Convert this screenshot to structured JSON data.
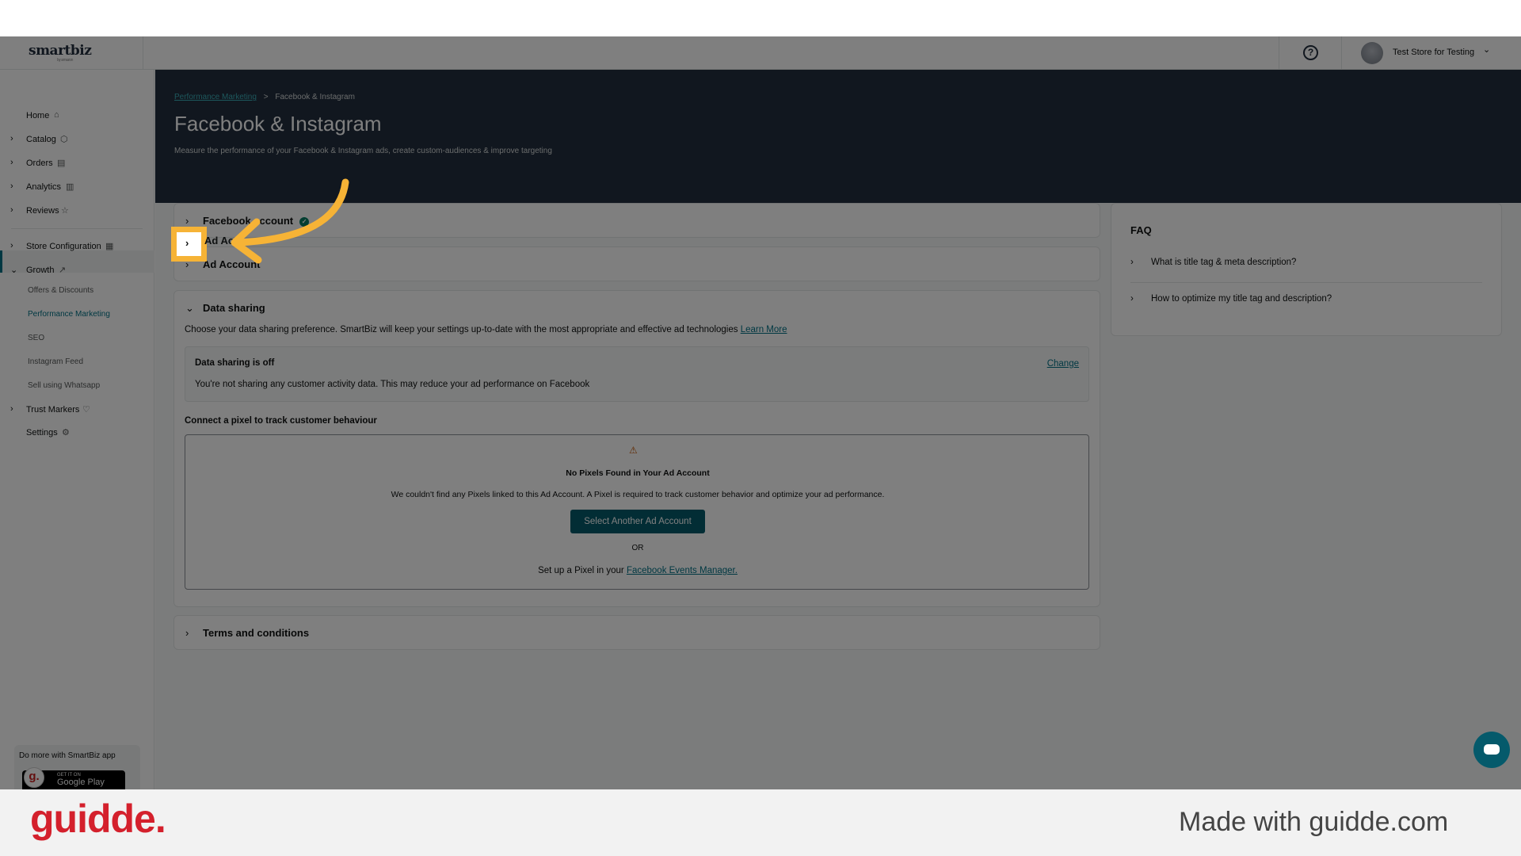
{
  "topbar": {
    "logo": "smartbiz",
    "logo_sub": "by amazon",
    "help": "?",
    "store_name": "Test Store for Testing",
    "menu_chevron": "⌄"
  },
  "sidebar": {
    "items": [
      {
        "label": "Home",
        "icon": "home-icon"
      },
      {
        "label": "Catalog",
        "icon": "cube-icon"
      },
      {
        "label": "Orders",
        "icon": "clipboard-icon"
      },
      {
        "label": "Analytics",
        "icon": "bar-chart-icon"
      },
      {
        "label": "Reviews",
        "icon": "star-icon"
      },
      {
        "label": "Store Configuration",
        "icon": "store-icon"
      },
      {
        "label": "Growth",
        "icon": "trend-up-icon"
      },
      {
        "label": "Trust Markers",
        "icon": "shield-heart-icon"
      },
      {
        "label": "Settings",
        "icon": "gear-icon"
      }
    ],
    "growth_sub": [
      {
        "label": "Offers & Discounts"
      },
      {
        "label": "Performance Marketing"
      },
      {
        "label": "SEO"
      },
      {
        "label": "Instagram Feed"
      },
      {
        "label": "Sell using Whatsapp"
      }
    ],
    "promo_text": "Do more with SmartBiz app",
    "store_badge_small": "GET IT ON",
    "store_badge": "Google Play",
    "guidde_badge": "g."
  },
  "header": {
    "breadcrumb_link": "Performance Marketing",
    "breadcrumb_sep": ">",
    "breadcrumb_current": "Facebook & Instagram",
    "title": "Facebook & Instagram",
    "subtitle": "Measure the performance of your Facebook & Instagram ads, create custom-audiences & improve targeting"
  },
  "sections": {
    "facebook_account": "Facebook account",
    "ad_account": "Ad Account",
    "ad_account_visible": "Ad Ac",
    "data_sharing": "Data sharing",
    "terms": "Terms and conditions"
  },
  "data_sharing": {
    "intro": "Choose your data sharing preference. SmartBiz will keep your settings up-to-date with the most appropriate and effective ad technologies",
    "learn_more": "Learn More",
    "status_title": "Data sharing is off",
    "status_desc": "You're not sharing any customer activity data. This may reduce your ad performance on Facebook",
    "change": "Change",
    "pixel_title": "Connect a pixel to track customer behaviour",
    "no_pixels_title": "No Pixels Found in Your Ad Account",
    "no_pixels_desc": "We couldn't find any Pixels linked to this Ad Account. A Pixel is required to track customer behavior and optimize your ad performance.",
    "select_button": "Select Another Ad Account",
    "or": "OR",
    "setup_prefix": "Set up a Pixel in your",
    "setup_link": "Facebook Events Manager."
  },
  "faq": {
    "title": "FAQ",
    "items": [
      {
        "label": "What is title tag & meta description?"
      },
      {
        "label": "How to optimize my title tag and description?"
      }
    ]
  },
  "footer": {
    "brand": "guidde.",
    "made_with": "Made with guidde.com"
  },
  "colors": {
    "header_band": "#232f3e",
    "teal_accent": "#007185",
    "button": "#055a6b",
    "highlight": "#f6b336",
    "guidde_red": "#d4202c"
  }
}
